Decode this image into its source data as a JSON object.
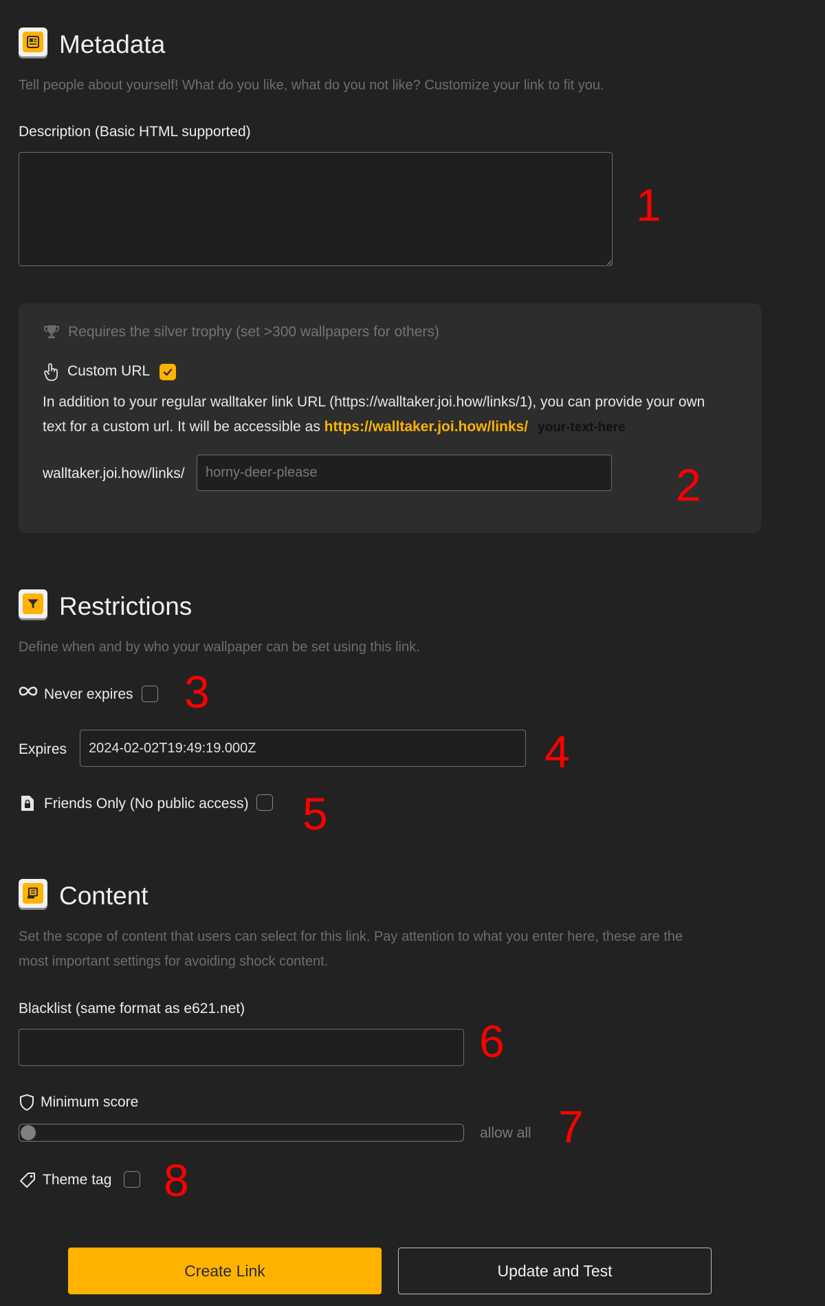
{
  "metadata": {
    "title": "Metadata",
    "description": "Tell people about yourself! What do you like, what do you not like? Customize your link to fit you.",
    "description_label": "Description (Basic HTML supported)",
    "description_value": ""
  },
  "custom_url": {
    "requirement": "Requires the silver trophy (set >300 wallpapers for others)",
    "label": "Custom URL",
    "checked": true,
    "help_line1": "In addition to your regular walltaker link URL (https://walltaker.joi.how/links/1), you can provide your own",
    "help_line2_prefix": "text for a custom url. It will be accessible as ",
    "help_link": "https://walltaker.joi.how/links/",
    "help_suffix": "your-text-here",
    "prefix": "walltaker.joi.how/links/",
    "placeholder": "horny-deer-please"
  },
  "restrictions": {
    "title": "Restrictions",
    "description": "Define when and by who your wallpaper can be set using this link.",
    "never_expires_label": "Never expires",
    "expires_label": "Expires",
    "expires_value": "2024-02-02T19:49:19.000Z",
    "friends_only_label": "Friends Only (No public access)"
  },
  "content": {
    "title": "Content",
    "description_line1": "Set the scope of content that users can select for this link. Pay attention to what you enter here, these are the",
    "description_line2": "most important settings for avoiding shock content.",
    "blacklist_label": "Blacklist (same format as e621.net)",
    "blacklist_value": "",
    "min_score_label": "Minimum score",
    "min_score_value_text": "allow all",
    "min_score_fraction": 0,
    "theme_tag_label": "Theme tag"
  },
  "buttons": {
    "create": "Create Link",
    "update": "Update and Test"
  },
  "annotations": [
    "1",
    "2",
    "3",
    "4",
    "5",
    "6",
    "7",
    "8"
  ],
  "colors": {
    "accent": "#ffb300",
    "background": "#222222",
    "panel": "#2d2d2d",
    "annotation": "#ff0000"
  },
  "icons": {
    "metadata": "newspaper-icon",
    "trophy": "trophy-icon",
    "custom_url": "pointer-hand-icon",
    "restrictions": "filter-icon",
    "never_expires": "infinity-icon",
    "friends_only": "file-lock-icon",
    "content": "receipt-icon",
    "min_score": "shield-icon",
    "theme_tag": "tag-icon"
  }
}
